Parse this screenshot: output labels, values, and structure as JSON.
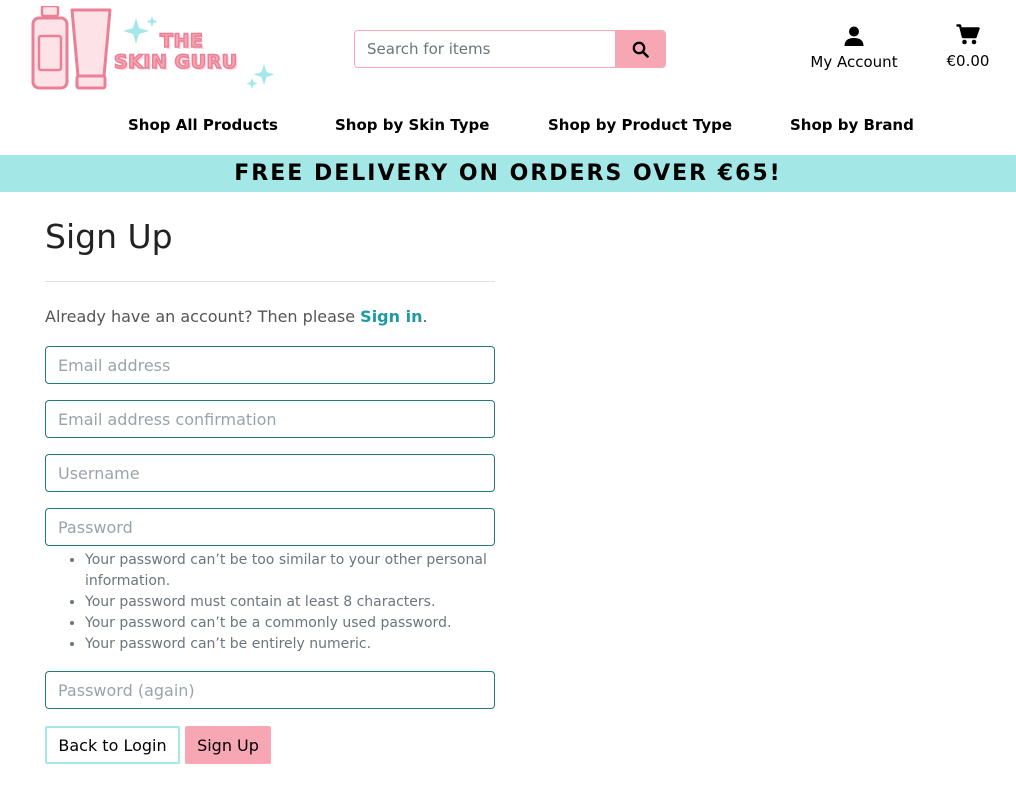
{
  "brand": {
    "line1": "THE",
    "line2": "SKIN GURU",
    "accent": "#f7a6b4",
    "teal": "#a3e7e6",
    "link": "#1d9aa6"
  },
  "search": {
    "placeholder": "Search for items",
    "icon": "search-icon"
  },
  "account": {
    "label": "My Account",
    "icon": "user-icon"
  },
  "cart": {
    "total": "€0.00",
    "icon": "shopping-cart-icon"
  },
  "nav": [
    {
      "label": "Shop All Products"
    },
    {
      "label": "Shop by Skin Type"
    },
    {
      "label": "Shop by Product Type"
    },
    {
      "label": "Shop by Brand"
    }
  ],
  "banner": {
    "text": "FREE DELIVERY ON ORDERS OVER €65!"
  },
  "form": {
    "title": "Sign Up",
    "already_prefix": "Already have an account? Then please ",
    "signin_link": "Sign in",
    "already_suffix": ".",
    "fields": [
      {
        "placeholder": "Email address",
        "value": ""
      },
      {
        "placeholder": "Email address confirmation",
        "value": ""
      },
      {
        "placeholder": "Username",
        "value": ""
      },
      {
        "placeholder": "Password",
        "value": ""
      },
      {
        "placeholder": "Password (again)",
        "value": ""
      }
    ],
    "password_help": [
      "Your password can’t be too similar to your other personal information.",
      "Your password must contain at least 8 characters.",
      "Your password can’t be a commonly used password.",
      "Your password can’t be entirely numeric."
    ],
    "back_label": "Back to Login",
    "submit_label": "Sign Up"
  }
}
